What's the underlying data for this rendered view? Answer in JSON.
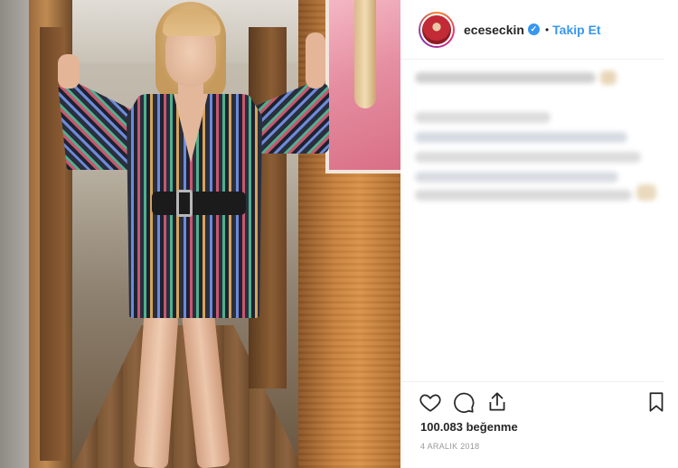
{
  "post": {
    "username": "eceseckin",
    "verified_icon": "verified-badge-icon",
    "separator": "•",
    "follow_label": "Takip Et",
    "likes_text": "100.083 beğenme",
    "date_text": "4 ARALIK 2018"
  },
  "actions": {
    "like_icon": "heart-icon",
    "comment_icon": "comment-icon",
    "share_icon": "share-icon",
    "save_icon": "bookmark-icon"
  },
  "colors": {
    "accent": "#3897f0",
    "text": "#262626",
    "muted": "#999999",
    "divider": "#efefef"
  }
}
